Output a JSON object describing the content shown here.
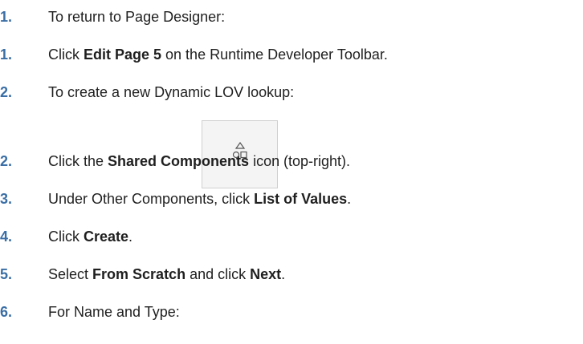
{
  "steps": [
    {
      "num": "1.",
      "pre": "To return to Page Designer:",
      "b1": "",
      "mid": "",
      "b2": "",
      "post": ""
    },
    {
      "num": "1.",
      "pre": "Click ",
      "b1": "Edit Page 5",
      "mid": " on the Runtime Developer Toolbar.",
      "b2": "",
      "post": ""
    },
    {
      "num": "2.",
      "pre": "To create a new Dynamic LOV lookup:",
      "b1": "",
      "mid": "",
      "b2": "",
      "post": ""
    },
    {
      "num": "2.",
      "pre": "Click the ",
      "b1": "Shared Components",
      "mid": " icon",
      "b2": "",
      "post": "(top-right)."
    },
    {
      "num": "3.",
      "pre": "Under Other Components, click ",
      "b1": "List of Values",
      "mid": ".",
      "b2": "",
      "post": ""
    },
    {
      "num": "4.",
      "pre": "Click ",
      "b1": "Create",
      "mid": ".",
      "b2": "",
      "post": ""
    },
    {
      "num": "5.",
      "pre": "Select ",
      "b1": "From Scratch",
      "mid": " and click ",
      "b2": "Next",
      "post": "."
    },
    {
      "num": "6.",
      "pre": "For Name and Type:",
      "b1": "",
      "mid": "",
      "b2": "",
      "post": ""
    }
  ],
  "icons": {
    "shared_components": "shapes-icon"
  }
}
